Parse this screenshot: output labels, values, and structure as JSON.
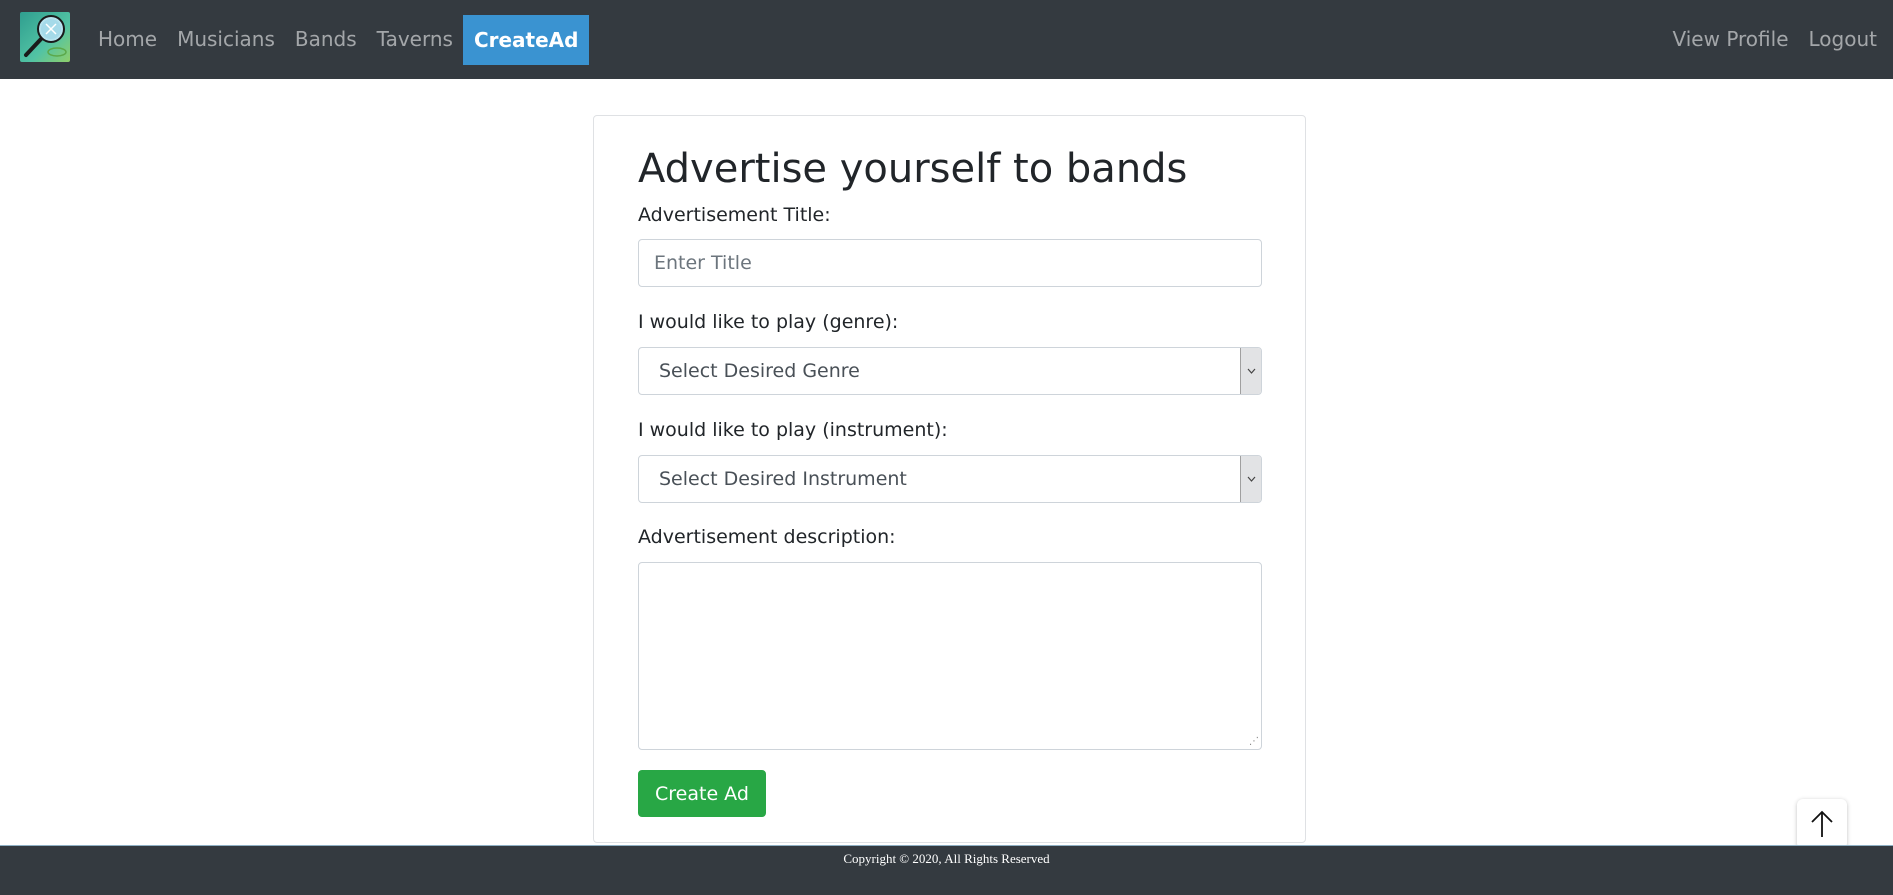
{
  "navbar": {
    "logo_icon": "magnifier-logo-icon",
    "links": [
      {
        "label": "Home"
      },
      {
        "label": "Musicians"
      },
      {
        "label": "Bands"
      },
      {
        "label": "Taverns"
      },
      {
        "label": "CreateAd",
        "active": true
      }
    ],
    "right_links": [
      {
        "label": "View Profile"
      },
      {
        "label": "Logout"
      }
    ]
  },
  "form": {
    "heading": "Advertise yourself to bands",
    "title_label": "Advertisement Title:",
    "title_placeholder": "Enter Title",
    "title_value": "",
    "genre_label": "I would like to play (genre):",
    "genre_selected": "Select Desired Genre",
    "instrument_label": "I would like to play (instrument):",
    "instrument_selected": "Select Desired Instrument",
    "description_label": "Advertisement description:",
    "description_value": "",
    "submit_label": "Create Ad"
  },
  "footer": {
    "copyright": "Copyright © 2020, All Rights Reserved"
  },
  "scroll_top_icon": "arrow-up-icon",
  "colors": {
    "navbar_bg": "#343a40",
    "active_nav_bg": "#3a93d1",
    "submit_bg": "#28a745"
  }
}
